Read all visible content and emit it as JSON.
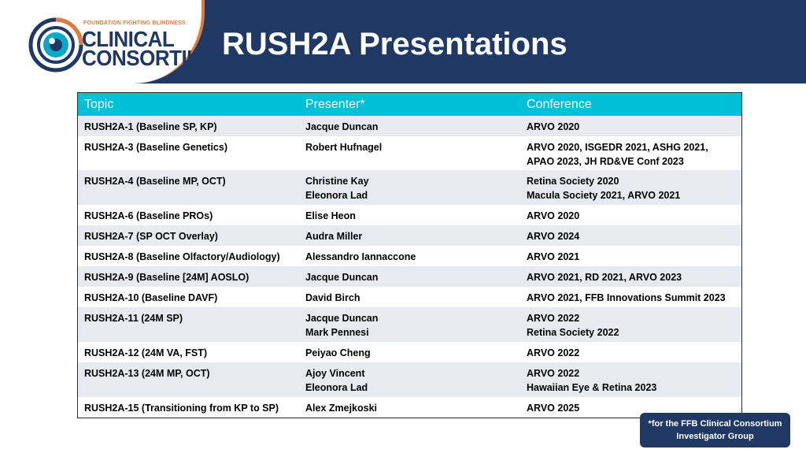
{
  "logo": {
    "tagline": "FOUNDATION FIGHTING BLINDNESS",
    "line1": "CLINICAL",
    "line2": "CONSORTIUM",
    "colors": {
      "navy": "#1f3864",
      "orange": "#e07b39",
      "cyan": "#00a9c9"
    }
  },
  "title": "RUSH2A Presentations",
  "table": {
    "headers": [
      "Topic",
      "Presenter*",
      "Conference"
    ],
    "rows": [
      {
        "topic": "RUSH2A-1 (Baseline SP, KP)",
        "presenters": [
          "Jacque Duncan"
        ],
        "conference": [
          "ARVO 2020"
        ]
      },
      {
        "topic": "RUSH2A-3 (Baseline Genetics)",
        "presenters": [
          "Robert Hufnagel"
        ],
        "conference": [
          "ARVO 2020, ISGEDR 2021, ASHG 2021,",
          "APAO 2023, JH RD&VE Conf 2023"
        ]
      },
      {
        "topic": "RUSH2A-4 (Baseline MP, OCT)",
        "presenters": [
          "Christine Kay",
          "Eleonora Lad"
        ],
        "conference": [
          "Retina Society 2020",
          "Macula Society 2021,  ARVO 2021"
        ]
      },
      {
        "topic": "RUSH2A-6 (Baseline PROs)",
        "presenters": [
          "Elise Heon"
        ],
        "conference": [
          "ARVO 2020"
        ]
      },
      {
        "topic": "RUSH2A-7 (SP OCT Overlay)",
        "presenters": [
          "Audra Miller"
        ],
        "conference": [
          "ARVO 2024"
        ]
      },
      {
        "topic": "RUSH2A-8 (Baseline Olfactory/Audiology)",
        "presenters": [
          "Alessandro Iannaccone"
        ],
        "conference": [
          "ARVO 2021"
        ]
      },
      {
        "topic": "RUSH2A-9 (Baseline [24M] AOSLO)",
        "presenters": [
          "Jacque Duncan"
        ],
        "conference": [
          "ARVO 2021, RD 2021, ARVO 2023"
        ]
      },
      {
        "topic": "RUSH2A-10 (Baseline DAVF)",
        "presenters": [
          "David Birch"
        ],
        "conference": [
          "ARVO 2021, FFB Innovations Summit 2023"
        ]
      },
      {
        "topic": "RUSH2A-11 (24M SP)",
        "presenters": [
          "Jacque Duncan",
          "Mark Pennesi"
        ],
        "conference": [
          "ARVO 2022",
          "Retina Society 2022"
        ]
      },
      {
        "topic": "RUSH2A-12 (24M VA, FST)",
        "presenters": [
          "Peiyao Cheng"
        ],
        "conference": [
          "ARVO 2022"
        ]
      },
      {
        "topic": "RUSH2A-13 (24M MP, OCT)",
        "presenters": [
          "Ajoy Vincent",
          "Eleonora Lad"
        ],
        "conference": [
          "ARVO 2022",
          "Hawaiian Eye & Retina 2023"
        ]
      },
      {
        "topic": "RUSH2A-15 (Transitioning from KP to SP)",
        "presenters": [
          "Alex Zmejkoski"
        ],
        "conference": [
          "ARVO 2025"
        ]
      }
    ],
    "colors": {
      "header_bg": "#00c0d8",
      "alt_row": "#e8eaf1"
    }
  },
  "footnote": {
    "line1": "*for the FFB Clinical Consortium",
    "line2": "Investigator Group"
  }
}
